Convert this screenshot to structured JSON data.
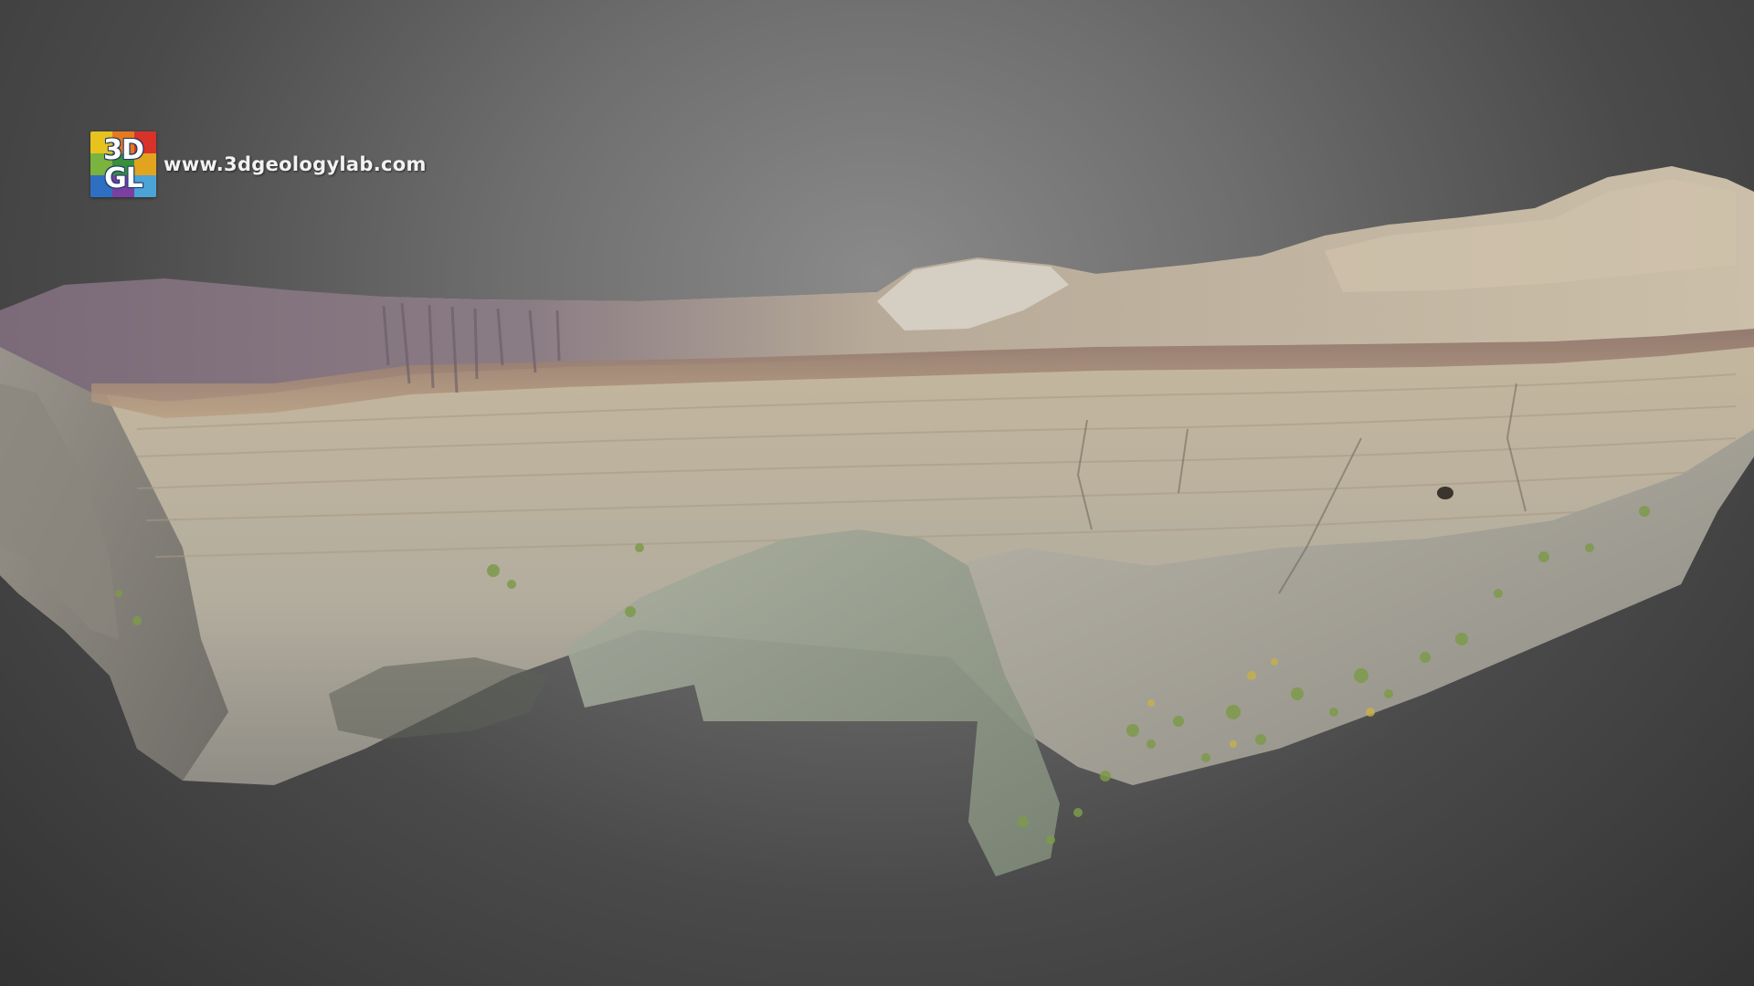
{
  "viewer": {
    "background_top": "#8a8a8a",
    "background_bottom": "#333333"
  },
  "watermark": {
    "logo_line1": "3D",
    "logo_line2": "GL",
    "url": "www.3dgeologylab.com",
    "logo_colors": [
      "#e8c31e",
      "#e77a1f",
      "#d8322a",
      "#3a8f3c",
      "#2f6fc2",
      "#7b3fa0"
    ]
  },
  "model": {
    "subject": "3d-scanned-sediment-outcrop",
    "icon": "outcrop-3d-model"
  }
}
